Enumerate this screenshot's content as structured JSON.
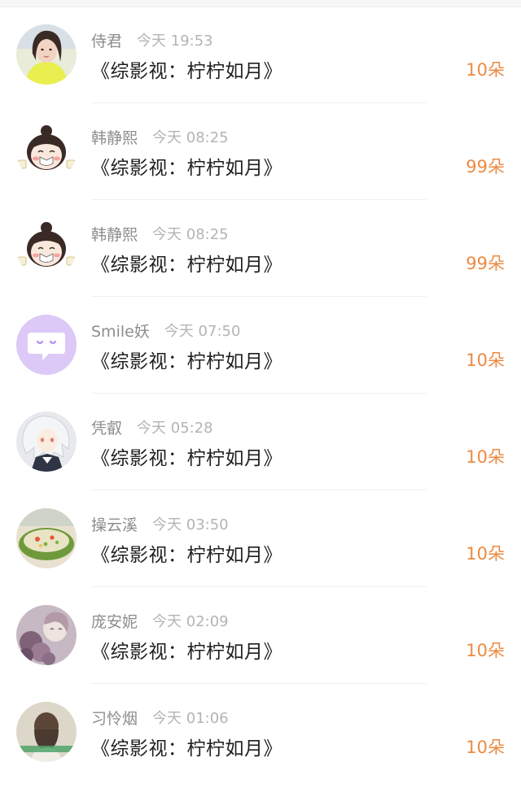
{
  "gift_records": [
    {
      "name": "侍君",
      "time": "今天 19:53",
      "title": "《综影视：柠柠如月》",
      "amount": "10朵",
      "avatar_icon": "girl-photo-avatar-icon"
    },
    {
      "name": "韩静熙",
      "time": "今天 08:25",
      "title": "《综影视：柠柠如月》",
      "amount": "99朵",
      "avatar_icon": "cartoon-girl-avatar-icon"
    },
    {
      "name": "韩静熙",
      "time": "今天 08:25",
      "title": "《综影视：柠柠如月》",
      "amount": "99朵",
      "avatar_icon": "cartoon-girl-avatar-icon"
    },
    {
      "name": "Smile妖",
      "time": "今天 07:50",
      "title": "《综影视：柠柠如月》",
      "amount": "10朵",
      "avatar_icon": "chat-bubble-avatar-icon"
    },
    {
      "name": "凭叡",
      "time": "今天 05:28",
      "title": "《综影视：柠柠如月》",
      "amount": "10朵",
      "avatar_icon": "anime-character-avatar-icon"
    },
    {
      "name": "操云溪",
      "time": "今天 03:50",
      "title": "《综影视：柠柠如月》",
      "amount": "10朵",
      "avatar_icon": "food-dish-avatar-icon"
    },
    {
      "name": "庞安妮",
      "time": "今天 02:09",
      "title": "《综影视：柠柠如月》",
      "amount": "10朵",
      "avatar_icon": "flowers-photo-avatar-icon"
    },
    {
      "name": "习怜烟",
      "time": "今天 01:06",
      "title": "《综影视：柠柠如月》",
      "amount": "10朵",
      "avatar_icon": "girl-back-avatar-icon"
    }
  ],
  "colors": {
    "amount": "#ec8a42",
    "name": "#8d8d8d",
    "time": "#b4b4b4",
    "title": "#1f1f1f",
    "divider": "#f0f0f0"
  }
}
